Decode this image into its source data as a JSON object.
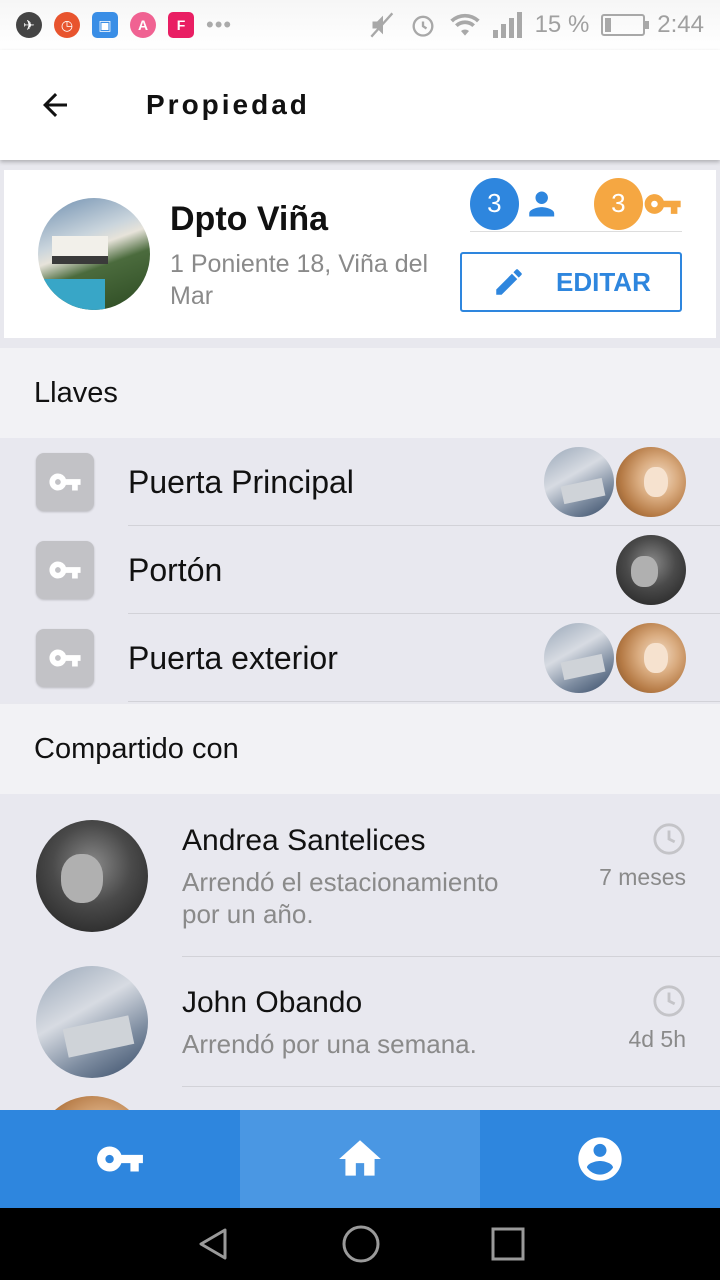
{
  "status_bar": {
    "battery": "15 %",
    "time": "2:44",
    "battery_level": 0.15
  },
  "header": {
    "title": "Propiedad"
  },
  "property": {
    "name": "Dpto Viña",
    "address": "1 Poniente 18, Viña del Mar",
    "users_count": "3",
    "keys_count": "3",
    "edit_label": "EDITAR"
  },
  "keys_section": {
    "title": "Llaves",
    "items": [
      {
        "label": "Puerta Principal"
      },
      {
        "label": "Portón"
      },
      {
        "label": "Puerta exterior"
      }
    ]
  },
  "shared_section": {
    "title": "Compartido con",
    "users": [
      {
        "name": "Andrea Santelices",
        "description": "Arrendó el estacionamiento por un año.",
        "time": "7 meses"
      },
      {
        "name": "John Obando",
        "description": "Arrendó por una semana.",
        "time": "4d 5h"
      }
    ]
  },
  "bottom_nav": {
    "items": [
      {
        "icon": "key-icon",
        "active": false
      },
      {
        "icon": "home-icon",
        "active": true
      },
      {
        "icon": "account-icon",
        "active": false
      }
    ]
  },
  "colors": {
    "primary": "#2e86de",
    "accent": "#f5a742",
    "key_bg": "#c2c2c6"
  }
}
